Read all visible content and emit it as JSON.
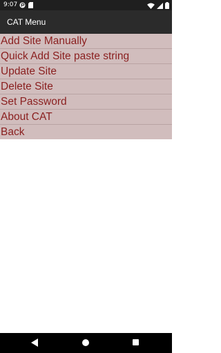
{
  "status_bar": {
    "time": "9:07",
    "icons": [
      "notification-icon",
      "sd-card-icon",
      "wifi-icon",
      "signal-icon",
      "battery-icon"
    ]
  },
  "app_bar": {
    "title": "CAT Menu"
  },
  "menu": {
    "items": [
      {
        "label": "Add Site Manually"
      },
      {
        "label": "Quick Add Site paste string"
      },
      {
        "label": "Update Site"
      },
      {
        "label": "Delete Site"
      },
      {
        "label": "Set Password"
      },
      {
        "label": "About CAT"
      },
      {
        "label": "Back"
      }
    ]
  },
  "colors": {
    "menu_background": "#d1bdbd",
    "menu_text": "#8a1f1f",
    "app_bar": "#2b2b2b",
    "status_bar": "#1f1f1f"
  },
  "nav_bar": {
    "icons": [
      "back-icon",
      "home-icon",
      "recents-icon"
    ]
  }
}
